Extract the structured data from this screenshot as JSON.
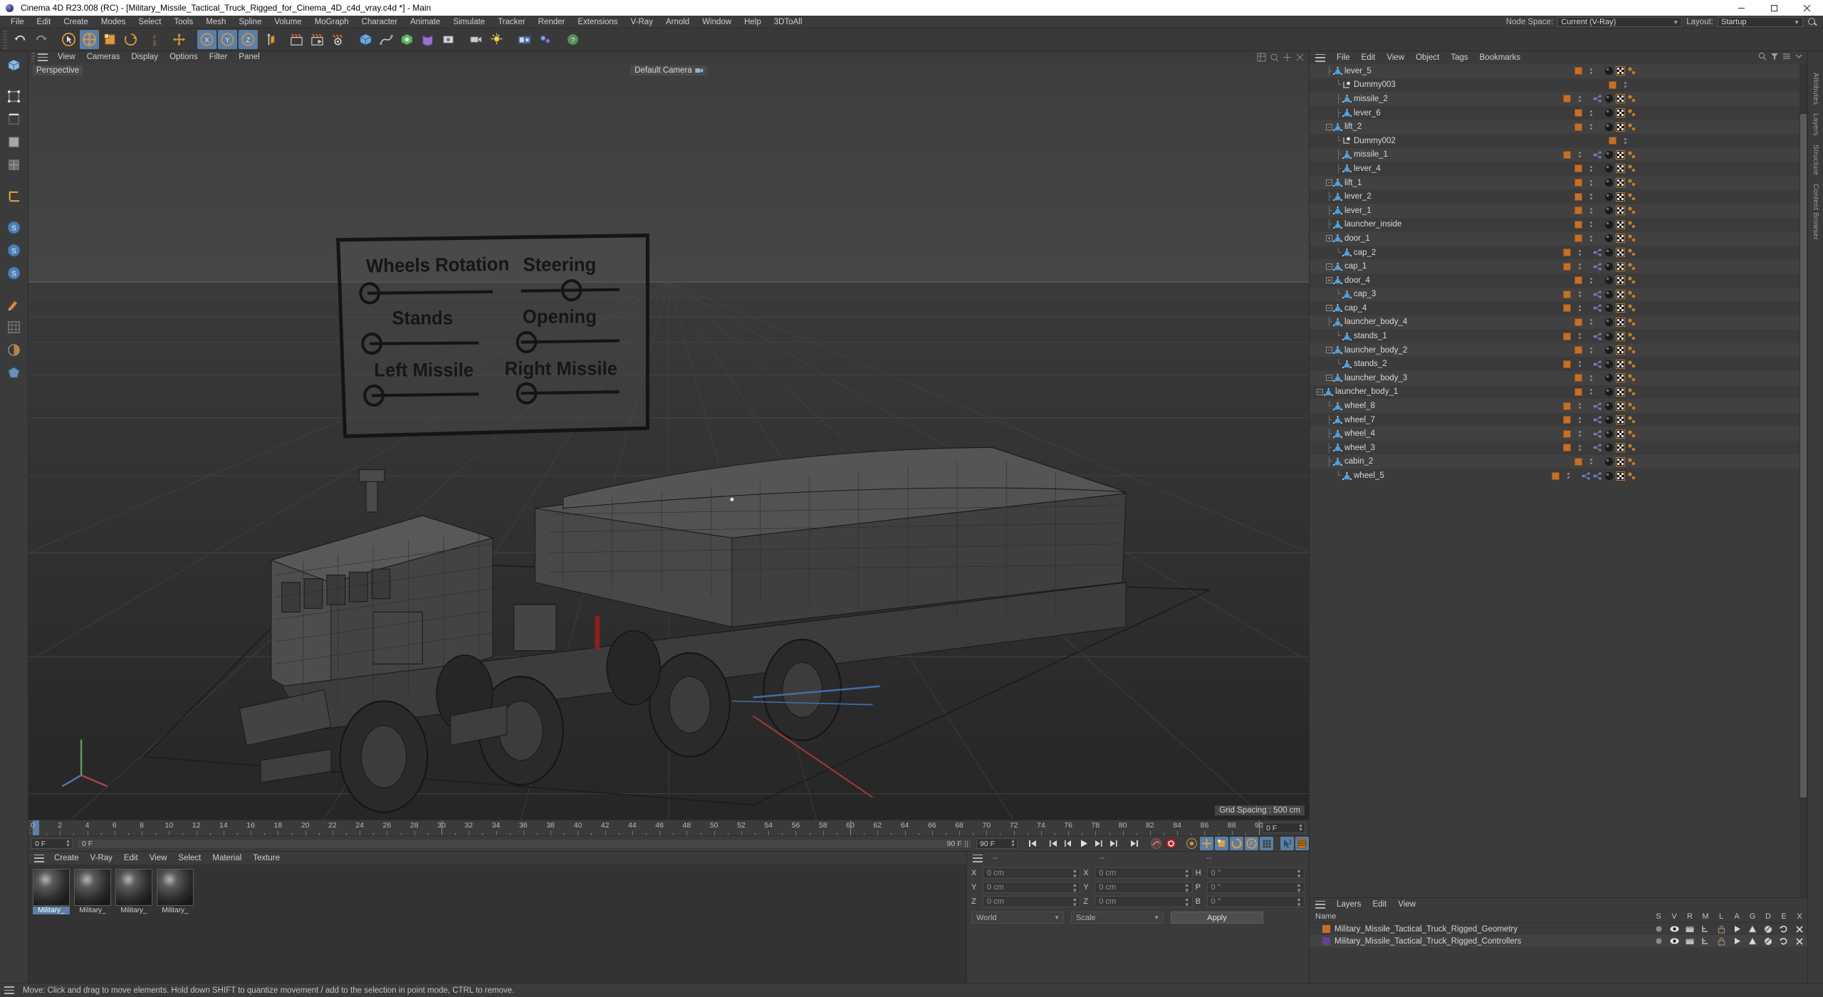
{
  "window": {
    "title": "Cinema 4D R23.008 (RC) - [Military_Missile_Tactical_Truck_Rigged_for_Cinema_4D_c4d_vray.c4d *] - Main",
    "minimize": "─",
    "maximize": "☐",
    "close": "✕"
  },
  "menubar": {
    "items": [
      "File",
      "Edit",
      "Create",
      "Modes",
      "Select",
      "Tools",
      "Mesh",
      "Spline",
      "Volume",
      "MoGraph",
      "Character",
      "Animate",
      "Simulate",
      "Tracker",
      "Render",
      "Extensions",
      "V-Ray",
      "Arnold",
      "Window",
      "Help",
      "3DToAll"
    ],
    "node_space_label": "Node Space:",
    "node_space_value": "Current (V-Ray)",
    "layout_label": "Layout:",
    "layout_value": "Startup"
  },
  "viewport": {
    "menu": [
      "View",
      "Cameras",
      "Display",
      "Options",
      "Filter",
      "Panel"
    ],
    "perspective_label": "Perspective",
    "camera_label": "Default Camera",
    "grid_spacing": "Grid Spacing : 500 cm",
    "hud_panel": {
      "sliders": [
        {
          "label": "Wheels Rotation",
          "value": 0
        },
        {
          "label": "Steering",
          "value": 50
        },
        {
          "label": "Stands",
          "value": 0
        },
        {
          "label": "Opening",
          "value": 2
        },
        {
          "label": "Left Missile",
          "value": 0
        },
        {
          "label": "Right Missile",
          "value": 2
        }
      ]
    }
  },
  "timeline": {
    "start_frame": "0 F",
    "current_frame": "0 F",
    "end_frame": "90 F",
    "end_field": "90 F",
    "ticks": [
      0,
      2,
      4,
      6,
      8,
      10,
      12,
      14,
      16,
      18,
      20,
      22,
      24,
      26,
      28,
      30,
      32,
      34,
      36,
      38,
      40,
      42,
      44,
      46,
      48,
      50,
      52,
      54,
      56,
      58,
      60,
      62,
      64,
      66,
      68,
      70,
      72,
      74,
      76,
      78,
      80,
      82,
      84,
      86,
      88,
      90
    ],
    "playhead_frame": 0
  },
  "material_manager": {
    "menu": [
      "Create",
      "V-Ray",
      "Edit",
      "View",
      "Select",
      "Material",
      "Texture"
    ],
    "materials": [
      {
        "name": "Military_",
        "selected": true
      },
      {
        "name": "Military_",
        "selected": false
      },
      {
        "name": "Military_",
        "selected": false
      },
      {
        "name": "Military_",
        "selected": false
      }
    ]
  },
  "coordinates": {
    "header": [
      "--",
      "--",
      "--"
    ],
    "position": {
      "x_label": "X",
      "x": "0 cm",
      "y_label": "Y",
      "y": "0 cm",
      "z_label": "Z",
      "z": "0 cm"
    },
    "size": {
      "x_label": "X",
      "x": "0 cm",
      "y_label": "Y",
      "y": "0 cm",
      "z_label": "Z",
      "z": "0 cm"
    },
    "rotation": {
      "h_label": "H",
      "h": "0 °",
      "p_label": "P",
      "p": "0 °",
      "b_label": "B",
      "b": "0 °"
    },
    "system": "World",
    "mode": "Scale",
    "apply": "Apply"
  },
  "object_manager": {
    "menu": [
      "File",
      "Edit",
      "View",
      "Object",
      "Tags",
      "Bookmarks"
    ],
    "rows": [
      {
        "name": "wheel_5",
        "depth": 3,
        "marker": "last",
        "expander": "none",
        "tags": [
          "axis",
          "axis",
          "mat",
          "uv",
          "phong"
        ]
      },
      {
        "name": "cabin_2",
        "depth": 2,
        "marker": "mid",
        "expander": "none",
        "tags": [
          "mat",
          "uv",
          "phong"
        ]
      },
      {
        "name": "wheel_3",
        "depth": 2,
        "marker": "mid",
        "expander": "none",
        "tags": [
          "axis",
          "mat",
          "uv",
          "phong"
        ]
      },
      {
        "name": "wheel_4",
        "depth": 2,
        "marker": "mid",
        "expander": "none",
        "tags": [
          "axis",
          "mat",
          "uv",
          "phong"
        ]
      },
      {
        "name": "wheel_7",
        "depth": 2,
        "marker": "mid",
        "expander": "none",
        "tags": [
          "axis",
          "mat",
          "uv",
          "phong"
        ]
      },
      {
        "name": "wheel_8",
        "depth": 2,
        "marker": "last",
        "expander": "none",
        "tags": [
          "axis",
          "mat",
          "uv",
          "phong"
        ]
      },
      {
        "name": "launcher_body_1",
        "depth": 1,
        "marker": "mid",
        "expander": "minus",
        "tags": [
          "mat",
          "uv",
          "phong"
        ]
      },
      {
        "name": "launcher_body_3",
        "depth": 2,
        "marker": "mid",
        "expander": "minus",
        "tags": [
          "mat",
          "uv",
          "phong"
        ]
      },
      {
        "name": "stands_2",
        "depth": 3,
        "marker": "last",
        "expander": "none",
        "tags": [
          "axis",
          "mat",
          "uv",
          "phong"
        ]
      },
      {
        "name": "launcher_body_2",
        "depth": 2,
        "marker": "mid",
        "expander": "minus",
        "tags": [
          "mat",
          "uv",
          "phong"
        ]
      },
      {
        "name": "stands_1",
        "depth": 3,
        "marker": "last",
        "expander": "none",
        "tags": [
          "axis",
          "mat",
          "uv",
          "phong"
        ]
      },
      {
        "name": "launcher_body_4",
        "depth": 2,
        "marker": "mid",
        "expander": "none",
        "tags": [
          "mat",
          "uv",
          "phong"
        ]
      },
      {
        "name": "cap_4",
        "depth": 2,
        "marker": "mid",
        "expander": "minus",
        "tags": [
          "axis",
          "mat",
          "uv",
          "phong"
        ]
      },
      {
        "name": "cap_3",
        "depth": 3,
        "marker": "last",
        "expander": "none",
        "tags": [
          "axis",
          "mat",
          "uv",
          "phong"
        ]
      },
      {
        "name": "door_4",
        "depth": 2,
        "marker": "mid",
        "expander": "plus",
        "tags": [
          "mat",
          "uv",
          "phong"
        ]
      },
      {
        "name": "cap_1",
        "depth": 2,
        "marker": "mid",
        "expander": "minus",
        "tags": [
          "axis",
          "mat",
          "uv",
          "phong"
        ]
      },
      {
        "name": "cap_2",
        "depth": 3,
        "marker": "last",
        "expander": "none",
        "tags": [
          "axis",
          "mat",
          "uv",
          "phong"
        ]
      },
      {
        "name": "door_1",
        "depth": 2,
        "marker": "mid",
        "expander": "plus",
        "tags": [
          "mat",
          "uv",
          "phong"
        ]
      },
      {
        "name": "launcher_inside",
        "depth": 2,
        "marker": "mid",
        "expander": "none",
        "tags": [
          "mat",
          "uv",
          "phong"
        ]
      },
      {
        "name": "lever_1",
        "depth": 2,
        "marker": "mid",
        "expander": "none",
        "tags": [
          "mat",
          "uv",
          "phong"
        ]
      },
      {
        "name": "lever_2",
        "depth": 2,
        "marker": "mid",
        "expander": "none",
        "tags": [
          "mat",
          "uv",
          "phong"
        ]
      },
      {
        "name": "lift_1",
        "depth": 2,
        "marker": "mid",
        "expander": "minus",
        "tags": [
          "mat",
          "uv",
          "phong"
        ]
      },
      {
        "name": "lever_4",
        "depth": 3,
        "marker": "mid",
        "expander": "none",
        "tags": [
          "mat",
          "uv",
          "phong"
        ]
      },
      {
        "name": "missile_1",
        "depth": 3,
        "marker": "mid",
        "expander": "none",
        "tags": [
          "axis",
          "mat",
          "uv",
          "phong"
        ]
      },
      {
        "name": "Dummy002",
        "depth": 3,
        "marker": "last",
        "expander": "none",
        "icon": "null",
        "tags": []
      },
      {
        "name": "lift_2",
        "depth": 2,
        "marker": "mid",
        "expander": "minus",
        "tags": [
          "mat",
          "uv",
          "phong"
        ]
      },
      {
        "name": "lever_6",
        "depth": 3,
        "marker": "mid",
        "expander": "none",
        "tags": [
          "mat",
          "uv",
          "phong"
        ]
      },
      {
        "name": "missile_2",
        "depth": 3,
        "marker": "mid",
        "expander": "none",
        "tags": [
          "axis",
          "mat",
          "uv",
          "phong"
        ]
      },
      {
        "name": "Dummy003",
        "depth": 3,
        "marker": "last",
        "expander": "none",
        "icon": "null",
        "tags": []
      },
      {
        "name": "lever_5",
        "depth": 2,
        "marker": "mid",
        "expander": "none",
        "tags": [
          "mat",
          "uv",
          "phong"
        ]
      }
    ]
  },
  "layer_manager": {
    "menu": [
      "Layers",
      "Edit",
      "View"
    ],
    "name_col": "Name",
    "columns": [
      "S",
      "V",
      "R",
      "M",
      "L",
      "A",
      "G",
      "D",
      "E",
      "X"
    ],
    "rows": [
      {
        "name": "Military_Missile_Tactical_Truck_Rigged_Geometry",
        "color": "#c2702a"
      },
      {
        "name": "Military_Missile_Tactical_Truck_Rigged_Controllers",
        "color": "#6b3f8f"
      }
    ]
  },
  "right_strip": {
    "labels": [
      "Attributes",
      "Layers",
      "Structure",
      "Content Browser"
    ]
  },
  "statusbar": {
    "message": "Move: Click and drag to move elements. Hold down SHIFT to quantize movement / add to the selection in point mode, CTRL to remove."
  },
  "colors": {
    "accent_blue": "#5b7fa6",
    "orange": "#d4802a",
    "panel_bg": "#3b3b3b",
    "viewport_bg": "#3c3c3c"
  }
}
